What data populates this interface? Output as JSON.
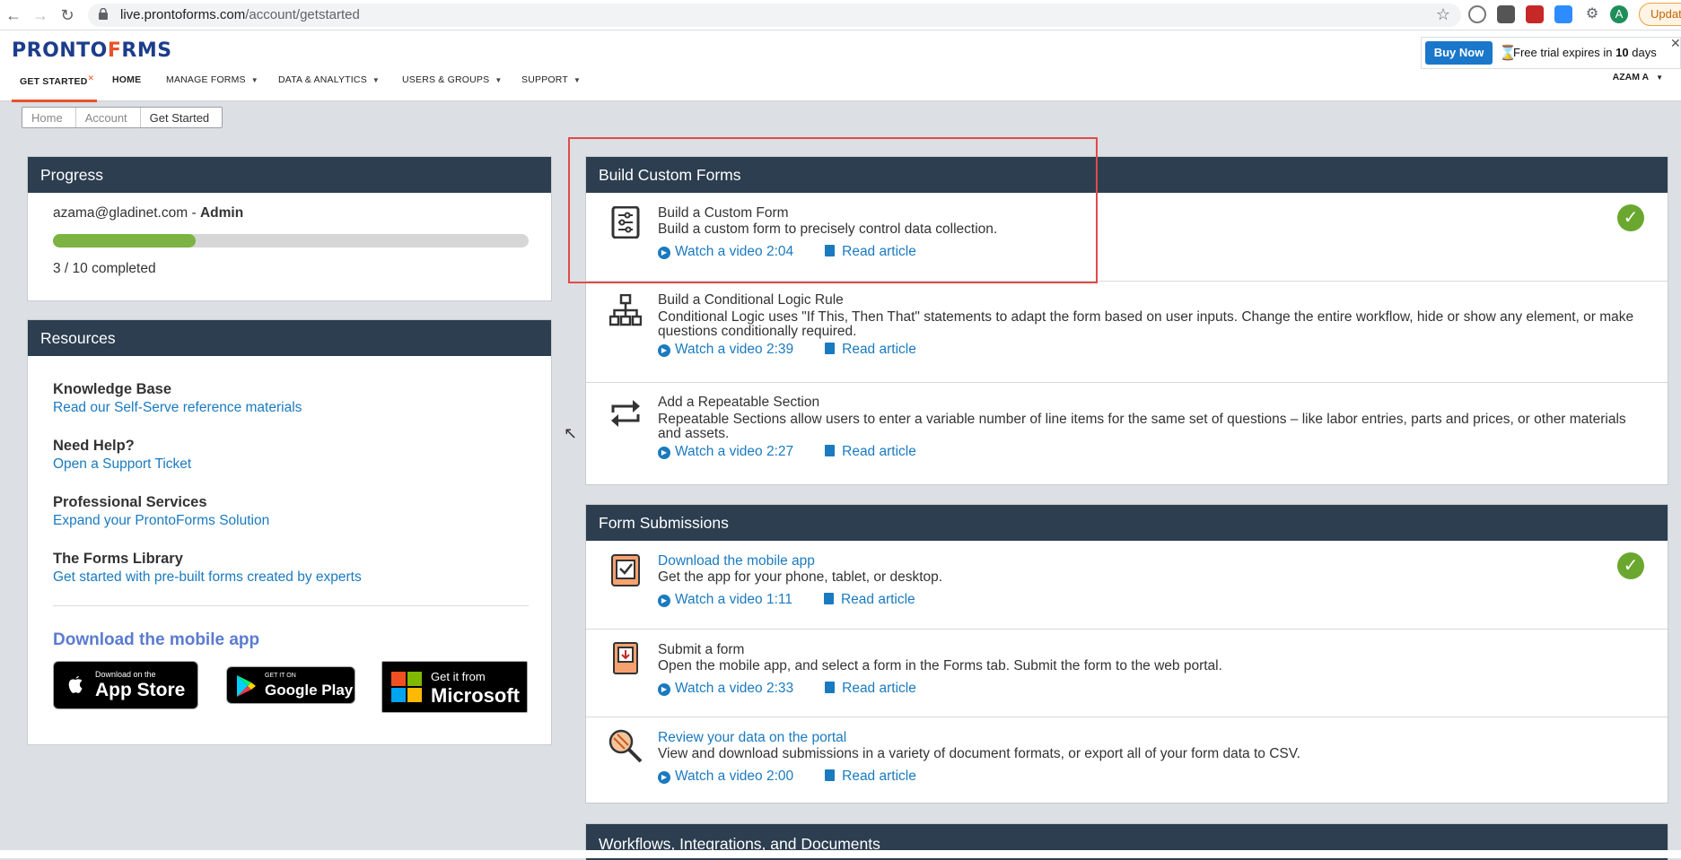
{
  "browser": {
    "url_host": "live.prontoforms.com",
    "url_path": "/account/getstarted",
    "update_label": "Update",
    "profile_initial": "A"
  },
  "header": {
    "logo_left": "PRONTO",
    "logo_accent": "F",
    "logo_right": "RMS",
    "buy_now": "Buy Now",
    "trial_text_prefix": "Free trial expires in ",
    "trial_days": "10",
    "trial_text_suffix": " days",
    "nav": {
      "get_started": "GET STARTED",
      "home": "HOME",
      "manage_forms": "MANAGE FORMS",
      "data_analytics": "DATA & ANALYTICS",
      "users_groups": "USERS & GROUPS",
      "support": "SUPPORT"
    },
    "user": "AZAM A"
  },
  "breadcrumb": [
    "Home",
    "Account",
    "Get Started"
  ],
  "progress": {
    "title": "Progress",
    "email": "azama@gladinet.com",
    "separator": " - ",
    "role": "Admin",
    "completed": 3,
    "total": 10,
    "completed_text": "3 / 10 completed",
    "accent": "#7cb342"
  },
  "resources": {
    "title": "Resources",
    "items": [
      {
        "title": "Knowledge Base",
        "link": "Read our Self-Serve reference materials"
      },
      {
        "title": "Need Help?",
        "link": "Open a Support Ticket"
      },
      {
        "title": "Professional Services",
        "link": "Expand your ProntoForms Solution"
      },
      {
        "title": "The Forms Library",
        "link": "Get started with pre-built forms created by experts"
      }
    ],
    "download_title": "Download the mobile app",
    "app_store": {
      "small": "Download on the",
      "big": "App Store"
    },
    "google_play": {
      "small": "GET IT ON",
      "big": "Google Play"
    },
    "microsoft": {
      "small": "Get it from",
      "big": "Microsoft"
    }
  },
  "build": {
    "title": "Build Custom Forms",
    "tasks": [
      {
        "title": "Build a Custom Form",
        "desc": "Build a custom form to precisely control data collection.",
        "video": "Watch a video 2:04",
        "article": "Read article",
        "done": true
      },
      {
        "title": "Build a Conditional Logic Rule",
        "desc": "Conditional Logic uses \"If This, Then That\" statements to adapt the form based on user inputs. Change the entire workflow, hide or show any element, or make questions conditionally required.",
        "video": "Watch a video 2:39",
        "article": "Read article",
        "done": false
      },
      {
        "title": "Add a Repeatable Section",
        "desc": "Repeatable Sections allow users to enter a variable number of line items for the same set of questions – like labor entries, parts and prices, or other materials and assets.",
        "video": "Watch a video 2:27",
        "article": "Read article",
        "done": false
      }
    ]
  },
  "submissions": {
    "title": "Form Submissions",
    "tasks": [
      {
        "title": "Download the mobile app",
        "desc": "Get the app for your phone, tablet, or desktop.",
        "video": "Watch a video 1:11",
        "article": "Read article",
        "done": true
      },
      {
        "title": "Submit a form",
        "desc": "Open the mobile app, and select a form in the Forms tab. Submit the form to the web portal.",
        "video": "Watch a video 2:33",
        "article": "Read article",
        "done": false
      },
      {
        "title": "Review your data on the portal",
        "desc": "View and download submissions in a variety of document formats, or export all of your form data to CSV.",
        "video": "Watch a video 2:00",
        "article": "Read article",
        "done": false
      }
    ]
  },
  "workflows": {
    "title": "Workflows, Integrations, and Documents"
  },
  "colors": {
    "panel_header": "#2c3e50",
    "link": "#1a7ac0",
    "check": "#6aa72f",
    "highlight": "#e04b4b",
    "brand_orange": "#e8522b"
  }
}
